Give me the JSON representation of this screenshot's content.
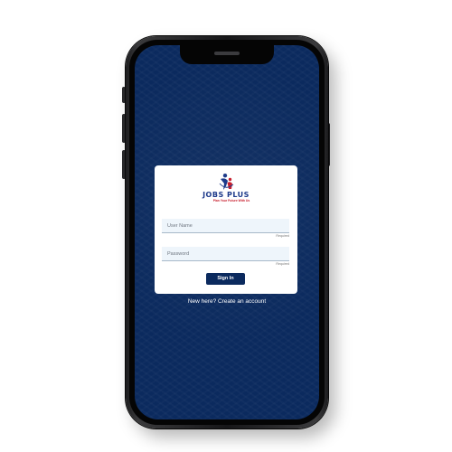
{
  "login": {
    "logo": {
      "name": "JOBS PLUS",
      "tagline": "Plan Your Future With Us"
    },
    "username": {
      "placeholder": "User Name",
      "value": "",
      "required_label": "Required"
    },
    "password": {
      "placeholder": "Password",
      "value": "",
      "required_label": "Required"
    },
    "signin_label": "Sign In",
    "create_account_label": "New here? Create an account"
  },
  "colors": {
    "screen_background": "#0b2a5e",
    "card_background": "#ffffff",
    "button_background": "#0b2a5e",
    "logo_text": "#1d3a8a",
    "logo_tagline": "#c8202f"
  },
  "icons": {
    "logo": "jobs-plus-people-logo-icon"
  }
}
